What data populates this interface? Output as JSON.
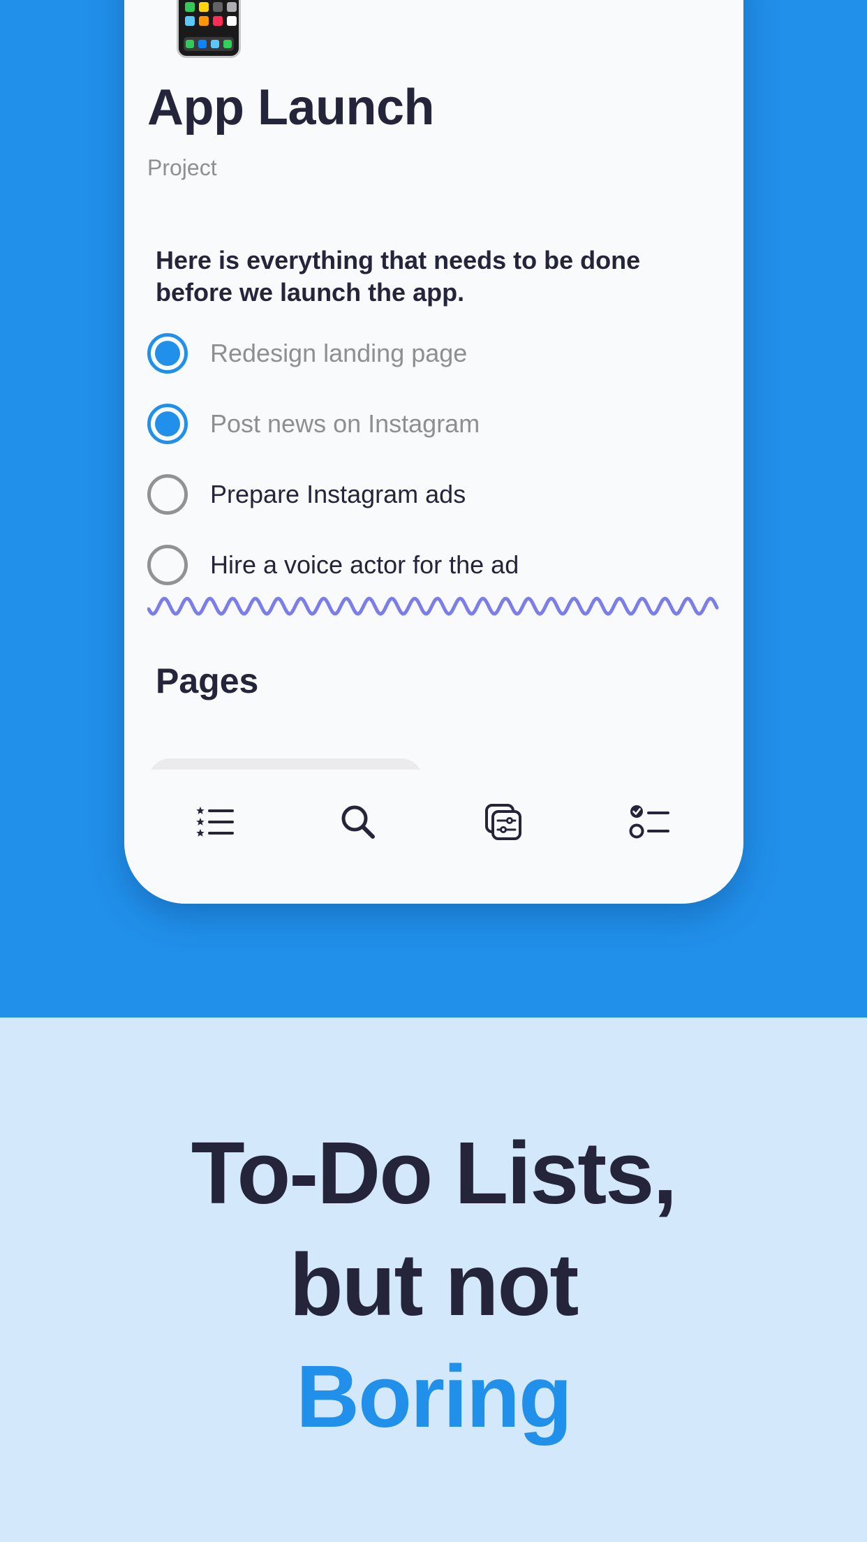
{
  "note": {
    "title": "App Launch",
    "subtitle": "Project",
    "intro": "Here is everything that needs to be done before we launch the app.",
    "todos": [
      {
        "label": "Redesign landing page",
        "done": true
      },
      {
        "label": "Post news on Instagram",
        "done": true
      },
      {
        "label": "Prepare Instagram ads",
        "done": false
      },
      {
        "label": "Hire a voice actor for the ad",
        "done": false
      }
    ],
    "pages_heading": "Pages"
  },
  "icons": {
    "app_icon": "phone-home-screen-icon",
    "tab_lists": "starred-list-icon",
    "tab_search": "search-icon",
    "tab_filters": "filter-cards-icon",
    "tab_todos": "checklist-icon"
  },
  "tagline": {
    "line1": "To-Do Lists,",
    "line2": "but not",
    "line3": "Boring"
  },
  "colors": {
    "accent": "#2190ea",
    "background_top": "#2190ea",
    "background_bottom": "#d3e8fb",
    "text_dark": "#24243a",
    "text_muted": "#8e8e93",
    "squiggle": "#7b7ee8"
  }
}
